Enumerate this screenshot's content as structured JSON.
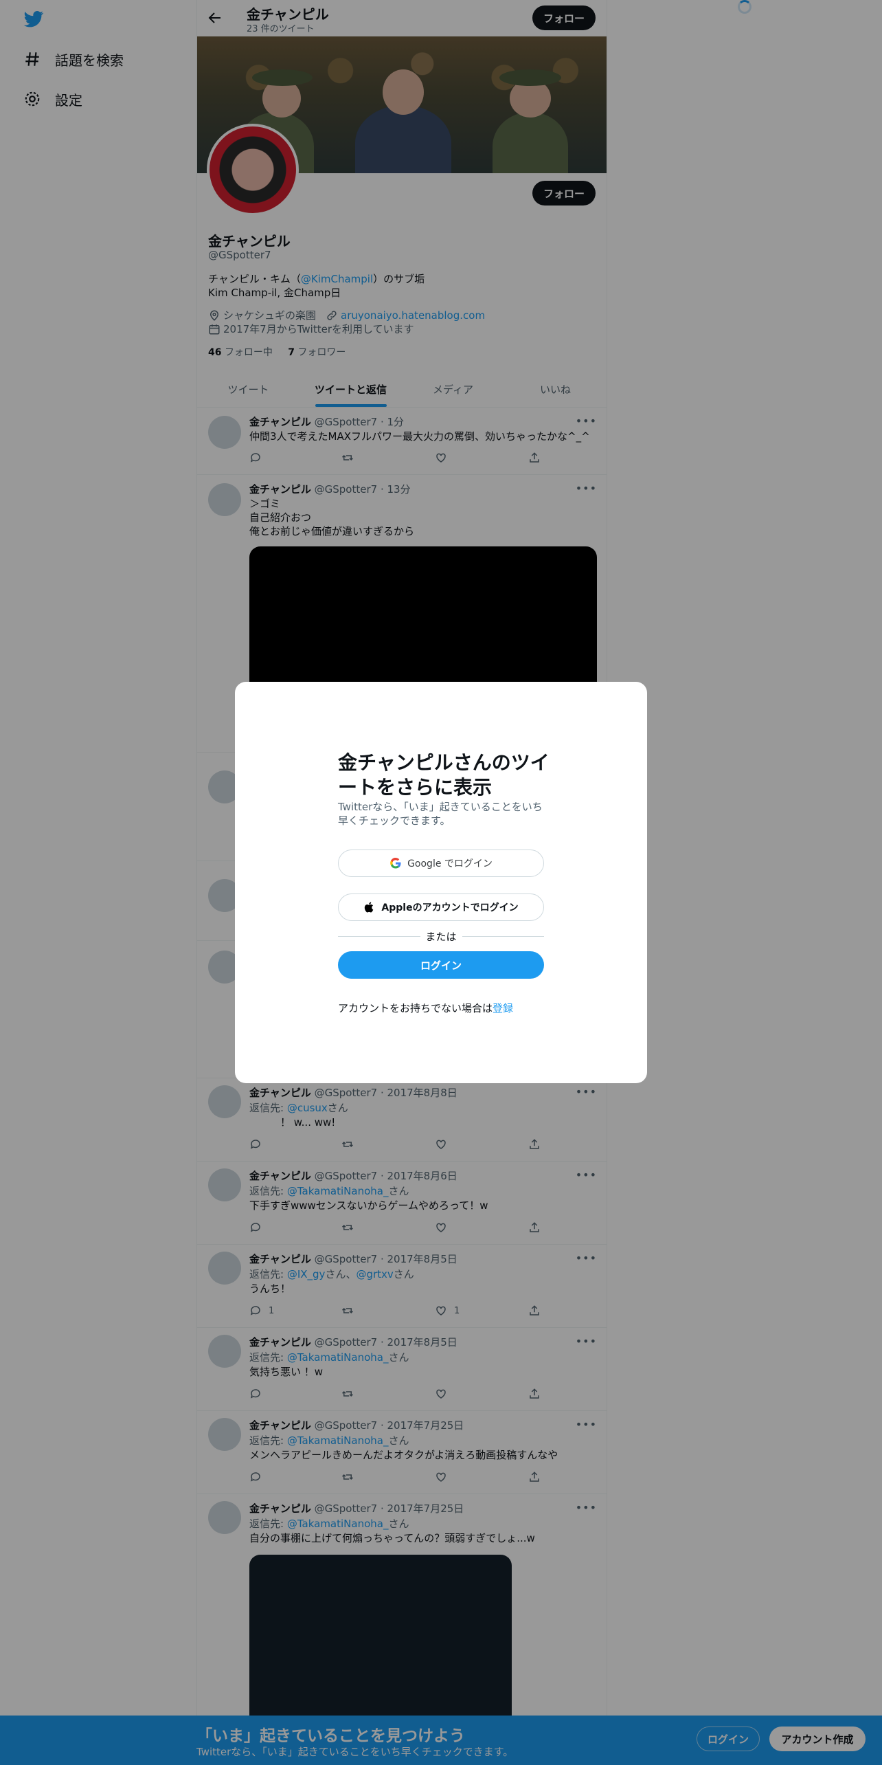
{
  "nav": {
    "logo": "twitter-bird",
    "explore_label": "話題を検索",
    "settings_label": "設定"
  },
  "topbar": {
    "name": "金チャンピル",
    "tweet_count": "23 件のツイート",
    "follow_label": "フォロー"
  },
  "profile": {
    "name": "金チャンピル",
    "handle": "@GSpotter7",
    "follow_label": "フォロー",
    "bio_line1_pre": "チャンピル・キム（",
    "bio_line1_link": "@KimChampil",
    "bio_line1_post": "）のサブ垢",
    "bio_line2": "Kim Champ-il, 金Champ日",
    "location": "シャケシュギの楽園",
    "website": "aruyonaiyo.hatenablog.com",
    "joined": "2017年7月からTwitterを利用しています",
    "following_count": "46",
    "following_label": "フォロー中",
    "followers_count": "7",
    "followers_label": "フォロワー"
  },
  "tabs": [
    {
      "label": "ツイート"
    },
    {
      "label": "ツイートと返信"
    },
    {
      "label": "メディア"
    },
    {
      "label": "いいね"
    }
  ],
  "tweets": [
    {
      "name": "金チャンピル",
      "meta": "@GSpotter7 · 1分",
      "text": "仲間3人で考えたMAXフルパワー最大火力の罵倒、効いちゃったかな^_^"
    },
    {
      "name": "金チャンピル",
      "meta": "@GSpotter7 · 13分",
      "text": "＞ゴミ\n自己紹介おつ\n俺とお前じゃ価値が違いすぎるから"
    },
    {
      "name": "金チャンピル",
      "meta": "@GSpotter7 · 2017年8月8日",
      "reply_prefix": "返信先: ",
      "reply_to": "@cusux",
      "reply_suffix": "さん",
      "text": "　　　！ w... ww!"
    },
    {
      "name": "金チャンピル",
      "meta": "@GSpotter7 · 2017年8月6日",
      "reply_prefix": "返信先: ",
      "reply_to": "@TakamatiNanoha_",
      "reply_suffix": "さん",
      "text": "下手すぎwwwセンスないからゲームやめろって！w"
    },
    {
      "name": "金チャンピル",
      "meta": "@GSpotter7 · 2017年8月5日",
      "reply_prefix": "返信先: ",
      "reply_to": "@IX_gy",
      "reply_mid": "さん、",
      "reply_to2": "@grtxv",
      "reply_suffix": "さん",
      "text": "うんち！",
      "reply_count": "1",
      "like_count": "1"
    },
    {
      "name": "金チャンピル",
      "meta": "@GSpotter7 · 2017年8月5日",
      "reply_prefix": "返信先: ",
      "reply_to": "@TakamatiNanoha_",
      "reply_suffix": "さん",
      "text": "気持ち悪い ！w"
    },
    {
      "name": "金チャンピル",
      "meta": "@GSpotter7 · 2017年7月25日",
      "reply_prefix": "返信先: ",
      "reply_to": "@TakamatiNanoha_",
      "reply_suffix": "さん",
      "text": "メンヘラアピールきめーんだよオタクがよ消えろ動画投稿すんなや"
    },
    {
      "name": "金チャンピル",
      "meta": "@GSpotter7 · 2017年7月25日",
      "reply_prefix": "返信先: ",
      "reply_to": "@TakamatiNanoha_",
      "reply_suffix": "さん",
      "text": "自分の事棚に上げて何煽っちゃってんの？頭弱すぎでしょ...w"
    }
  ],
  "modal": {
    "title": "金チャンピルさんのツイートをさらに表示",
    "subtitle": "Twitterなら、「いま」起きていることをいち早くチェックできます。",
    "google_label": "Google でログイン",
    "apple_label": "Appleのアカウントでログイン",
    "or_label": "または",
    "login_label": "ログイン",
    "signup_text": "アカウントをお持ちでない場合は",
    "signup_link": "登録"
  },
  "bottom_bar": {
    "title": "「いま」起きていることを見つけよう",
    "subtitle": "Twitterなら、「いま」起きていることをいち早くチェックできます。",
    "login_label": "ログイン",
    "signup_label": "アカウント作成"
  },
  "colors": {
    "accent": "#1d9bf0",
    "text": "#0f1419",
    "muted": "#536471"
  }
}
